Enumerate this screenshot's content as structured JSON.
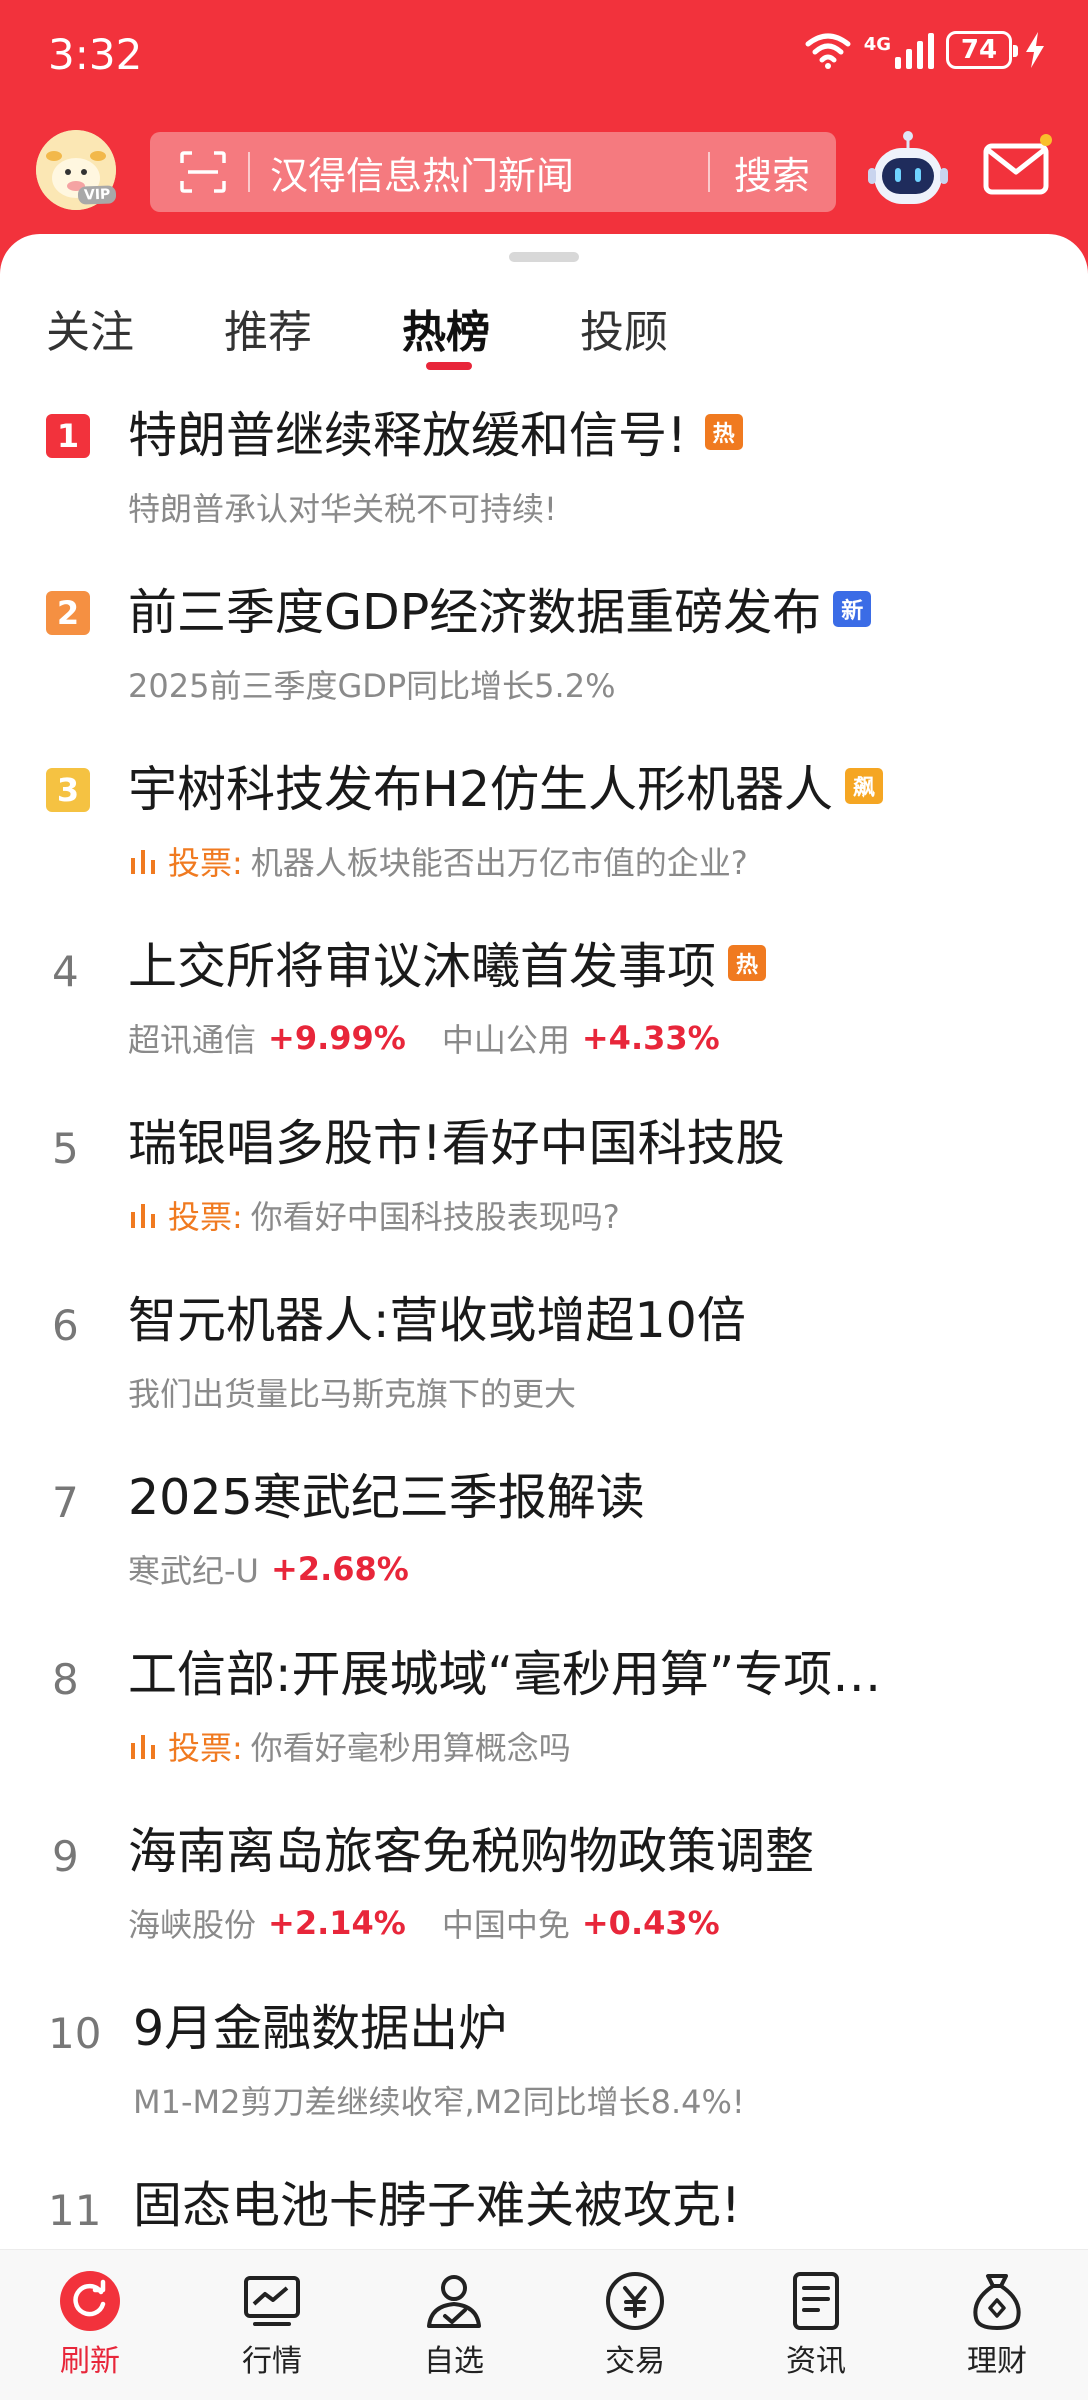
{
  "status_bar": {
    "time": "3:32",
    "network": "4G",
    "battery": "74"
  },
  "header": {
    "avatar_badge": "VIP",
    "search_placeholder": "汉得信息热门新闻",
    "search_button": "搜索"
  },
  "tabs": [
    {
      "label": "关注",
      "active": false
    },
    {
      "label": "推荐",
      "active": false
    },
    {
      "label": "热榜",
      "active": true
    },
    {
      "label": "投顾",
      "active": false
    }
  ],
  "hot_list": [
    {
      "rank": "1",
      "title": "特朗普继续释放缓和信号!",
      "tag": "热",
      "tag_color": "#f07a20",
      "sub": "特朗普承认对华关税不可持续!"
    },
    {
      "rank": "2",
      "title": "前三季度GDP经济数据重磅发布",
      "tag": "新",
      "tag_color": "#3b6ce6",
      "sub": "2025前三季度GDP同比增长5.2%"
    },
    {
      "rank": "3",
      "title": "宇树科技发布H2仿生人形机器人",
      "tag": "飙",
      "tag_color": "#f5a623",
      "vote_label": "投票:",
      "vote_text": "机器人板块能否出万亿市值的企业?"
    },
    {
      "rank": "4",
      "title": "上交所将审议沐曦首发事项",
      "tag": "热",
      "tag_color": "#f07a20",
      "stocks": [
        {
          "name": "超讯通信",
          "change": "+9.99%"
        },
        {
          "name": "中山公用",
          "change": "+4.33%"
        }
      ]
    },
    {
      "rank": "5",
      "title": "瑞银唱多股市!看好中国科技股",
      "vote_label": "投票:",
      "vote_text": "你看好中国科技股表现吗?"
    },
    {
      "rank": "6",
      "title": "智元机器人:营收或增超10倍",
      "sub": "我们出货量比马斯克旗下的更大"
    },
    {
      "rank": "7",
      "title": "2025寒武纪三季报解读",
      "stocks": [
        {
          "name": "寒武纪-U",
          "change": "+2.68%"
        }
      ]
    },
    {
      "rank": "8",
      "title": "工信部:开展城域“毫秒用算”专项…",
      "vote_label": "投票:",
      "vote_text": "你看好毫秒用算概念吗"
    },
    {
      "rank": "9",
      "title": "海南离岛旅客免税购物政策调整",
      "stocks": [
        {
          "name": "海峡股份",
          "change": "+2.14%"
        },
        {
          "name": "中国中免",
          "change": "+0.43%"
        }
      ]
    },
    {
      "rank": "10",
      "title": "9月金融数据出炉",
      "sub": "M1-M2剪刀差继续收窄,M2同比增长8.4%!"
    },
    {
      "rank": "11",
      "title": "固态电池卡脖子难关被攻克!"
    }
  ],
  "rank_badge_colors": [
    "#f2323c",
    "#f59042",
    "#f5c242"
  ],
  "bottom_nav": [
    {
      "label": "刷新",
      "icon": "refresh-icon",
      "active": true
    },
    {
      "label": "行情",
      "icon": "chart-icon",
      "active": false
    },
    {
      "label": "自选",
      "icon": "user-check-icon",
      "active": false
    },
    {
      "label": "交易",
      "icon": "yuan-icon",
      "active": false
    },
    {
      "label": "资讯",
      "icon": "document-icon",
      "active": false
    },
    {
      "label": "理财",
      "icon": "money-bag-icon",
      "active": false
    }
  ]
}
